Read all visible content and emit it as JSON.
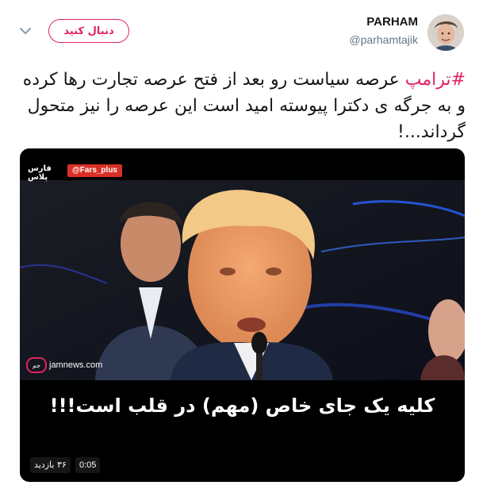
{
  "author": {
    "name": "PARHAM",
    "handle": "@parhamtajik"
  },
  "follow_button": {
    "label": "دنبال کنید"
  },
  "tweet": {
    "hashtag": "#ترامپ",
    "text_after_hashtag": " عرصه سیاست رو بعد از فتح عرصه تجارت رها کرده و به جرگه ی دکترا پیوسته امید است این عرصه را نیز متحول گرداند...!"
  },
  "video": {
    "channel_logo": "فارس پلاس",
    "source_badge": "@Fars_plus",
    "watermark": "jamnews.com",
    "watermark_mark": "جم",
    "caption": "کلیه یک جای خاص (مهم) در قلب است!!!",
    "views": "۳۶ بازدید",
    "duration": "0:05"
  },
  "colors": {
    "accent": "#e0245e",
    "text": "#14171a",
    "secondary_text": "#657786"
  }
}
